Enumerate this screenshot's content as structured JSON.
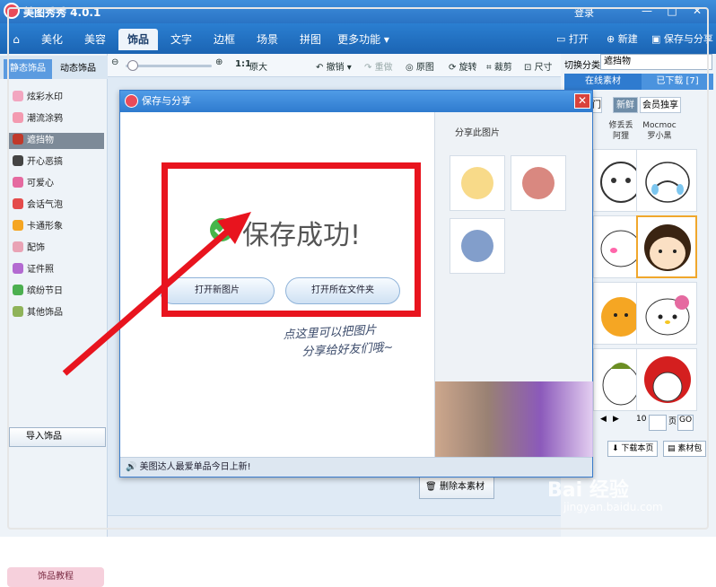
{
  "app": {
    "title": "美图秀秀 4.0.1",
    "login": "登录",
    "window_buttons": [
      "—",
      "□",
      "✕"
    ]
  },
  "tabs": [
    "美化",
    "美容",
    "饰品",
    "文字",
    "边框",
    "场景",
    "拼图",
    "更多功能"
  ],
  "active_tab": "饰品",
  "top_actions": {
    "open": "打开",
    "new": "新建",
    "save_share": "保存与分享"
  },
  "toolbar": {
    "zoom_ratio": "1:1",
    "original_size": "原大",
    "undo": "撤销",
    "redo": "重做",
    "original": "原图",
    "rotate": "旋转",
    "crop": "裁剪",
    "size": "尺寸"
  },
  "left_panel": {
    "tabs": [
      "静态饰品",
      "动态饰品"
    ],
    "categories": [
      {
        "label": "炫彩水印",
        "color": "#f2a6c0"
      },
      {
        "label": "潮流涂鸦",
        "color": "#f39ab0"
      },
      {
        "label": "遮挡物",
        "color": "#c0392b"
      },
      {
        "label": "开心恶搞",
        "color": "#444444"
      },
      {
        "label": "可爱心",
        "color": "#e56aa0"
      },
      {
        "label": "会话气泡",
        "color": "#e44b4b"
      },
      {
        "label": "卡通形象",
        "color": "#f5a623"
      },
      {
        "label": "配饰",
        "color": "#e9a3b5"
      },
      {
        "label": "证件照",
        "color": "#b36ad1"
      },
      {
        "label": "缤纷节日",
        "color": "#4caf50"
      },
      {
        "label": "其他饰品",
        "color": "#8fb35a"
      }
    ],
    "selected_category": "遮挡物",
    "import_button": "导入饰品",
    "tutorial_button": "饰品教程"
  },
  "right_panel": {
    "switch_label": "切换分类",
    "switch_value": "遮挡物",
    "tabs": [
      "在线素材",
      "已下载 [7]"
    ],
    "subtabs": [
      "门",
      "新鲜",
      "会员独享"
    ],
    "sources": [
      "修丢丢",
      "阿狸",
      "Mocmoc",
      "罗小黑"
    ],
    "page_suffix": "页",
    "page_value": "",
    "go_button": "GO",
    "page_prefix": "10",
    "download_more": "下载本页",
    "material_pack": "素材包"
  },
  "dialog": {
    "title": "保存与分享",
    "close": "✕",
    "success_text": "保存成功!",
    "buttons": [
      "打开新图片",
      "打开所在文件夹"
    ],
    "share_title": "分享此图片",
    "footer": "美图达人最爱单品今日上新!"
  },
  "annotation": {
    "note_line1": "点这里可以把图片",
    "note_line2": "分享给好友们哦~"
  },
  "delete_button": "删除本素材",
  "watermark": {
    "brand": "Bai 经验",
    "site": "jingyan.baidu.com"
  }
}
